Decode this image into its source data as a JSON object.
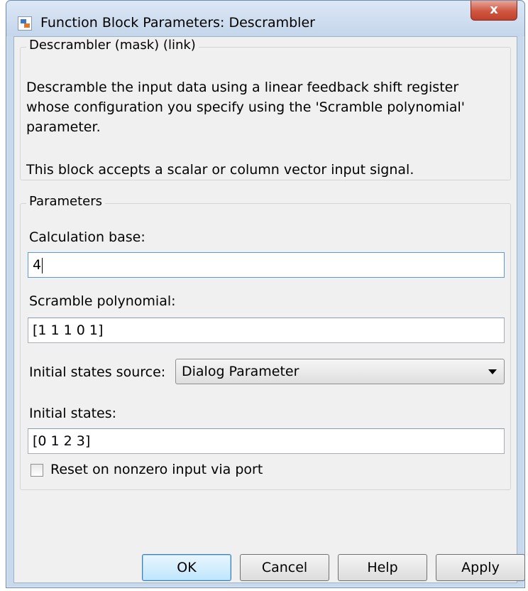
{
  "window": {
    "title": "Function Block Parameters: Descrambler",
    "close_label": "x"
  },
  "description": {
    "legend": "Descrambler (mask) (link)",
    "text": "Descramble the input data using a linear feedback shift register whose configuration you specify using the 'Scramble polynomial' parameter.",
    "text2": "This block accepts a scalar or column vector input signal."
  },
  "parameters": {
    "legend": "Parameters",
    "calculation_base": {
      "label": "Calculation base:",
      "value": "4"
    },
    "scramble_polynomial": {
      "label": "Scramble polynomial:",
      "value": "[1 1 1 0 1]"
    },
    "initial_states_source": {
      "label": "Initial states source:",
      "selected": "Dialog Parameter"
    },
    "initial_states": {
      "label": "Initial states:",
      "value": "[0 1 2 3]"
    },
    "reset_checkbox": {
      "label": "Reset on nonzero input via port",
      "checked": false
    }
  },
  "buttons": {
    "ok": "OK",
    "cancel": "Cancel",
    "help": "Help",
    "apply": "Apply"
  }
}
